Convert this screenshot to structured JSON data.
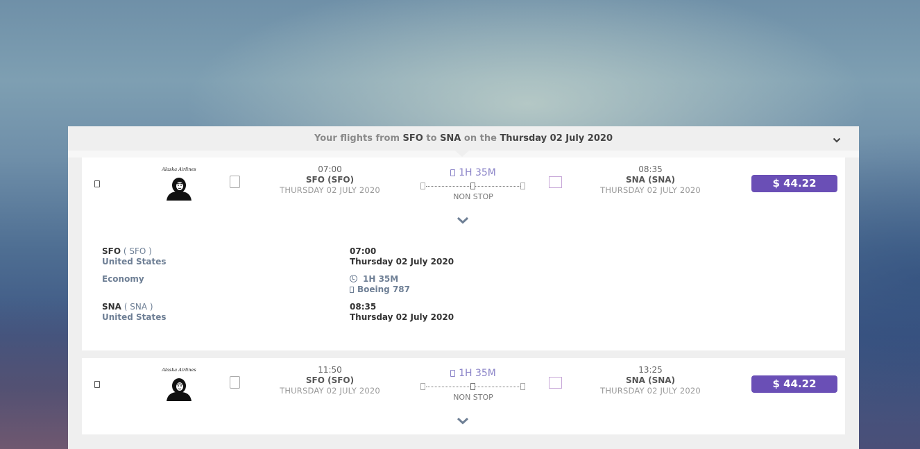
{
  "header": {
    "prefix": "Your flights from",
    "origin": "SFO",
    "to_word": "to",
    "destination": "SNA",
    "on_word": "on the",
    "date": "Thursday 02 July 2020"
  },
  "flights": [
    {
      "airline": "Alaska Airlines",
      "departure": {
        "time": "07:00",
        "airport": "SFO (SFO)",
        "date": "THURSDAY 02 JULY 2020"
      },
      "duration": "1H 35M",
      "stops": "NON STOP",
      "arrival": {
        "time": "08:35",
        "airport": "SNA (SNA)",
        "date": "THURSDAY 02 JULY 2020"
      },
      "price": "$ 44.22",
      "details": {
        "from_code": "SFO",
        "from_code_paren": "( SFO )",
        "from_country": "United States",
        "cabin": "Economy",
        "to_code": "SNA",
        "to_code_paren": "( SNA )",
        "to_country": "United States",
        "dep_time": "07:00",
        "dep_date": "Thursday 02 July 2020",
        "duration": "1H 35M",
        "aircraft": "Boeing 787",
        "arr_time": "08:35",
        "arr_date": "Thursday 02 July 2020"
      }
    },
    {
      "airline": "Alaska Airlines",
      "departure": {
        "time": "11:50",
        "airport": "SFO (SFO)",
        "date": "THURSDAY 02 JULY 2020"
      },
      "duration": "1H 35M",
      "stops": "NON STOP",
      "arrival": {
        "time": "13:25",
        "airport": "SNA (SNA)",
        "date": "THURSDAY 02 JULY 2020"
      },
      "price": "$ 44.22"
    }
  ],
  "colors": {
    "price_button": "#6a4fb6",
    "duration_text": "#8b84c8",
    "detail_label": "#6e7f95"
  }
}
